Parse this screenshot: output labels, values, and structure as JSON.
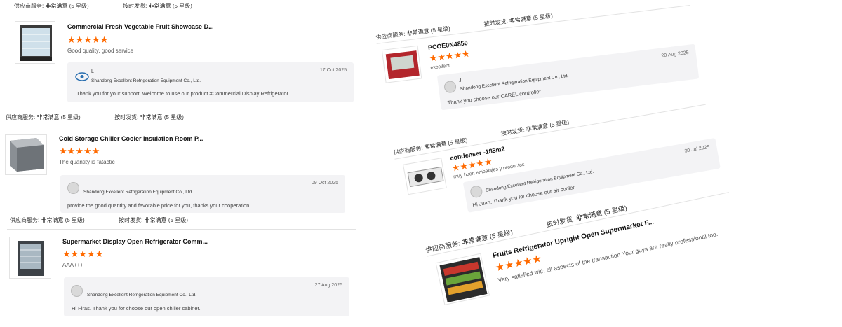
{
  "colors": {
    "star": "#ff6a00",
    "reply_bg": "#f3f3f5"
  },
  "header_labels": {
    "service": "供应商服务:",
    "ontime": "按时发货:",
    "rating": "非常满意",
    "stars": "(5 星级)"
  },
  "reviews_left": [
    {
      "title": "Commercial Fresh Vegetable Fruit Showcase D...",
      "stars": 5,
      "comment": "Good quality, good service",
      "reply": {
        "user": "L",
        "company": "Shandong Excellent Refrigeration Equipment Co., Ltd.",
        "date": "17 Oct 2025",
        "message": "Thank you for your support! Welcome to use our product #Commercial Display Refrigerator"
      }
    },
    {
      "title": "Cold Storage Chiller Cooler Insulation Room P...",
      "stars": 5,
      "comment": "The quantity is fatactic",
      "reply": {
        "company": "Shandong Excellent Refrigeration Equipment Co., Ltd.",
        "date": "09 Oct 2025",
        "message": "provide the good quantity and favorable price for you, thanks your cooperation"
      }
    },
    {
      "title": "Supermarket Display Open Refrigerator Comm...",
      "stars": 5,
      "comment": "AAA+++",
      "reply": {
        "company": "Shandong Excellent Refrigeration Equipment Co., Ltd.",
        "date": "27 Aug 2025",
        "message": "Hi Firas. Thank you for choose our open chiller cabinet."
      }
    }
  ],
  "reviews_right": [
    {
      "title": "PCOE0N4850",
      "stars": 5,
      "comment": "excellent",
      "reply": {
        "user": "J.",
        "company": "Shandong Excellent Refrigeration Equipment Co., Ltd.",
        "date": "20 Aug 2025",
        "message": "Thank you choose our CAREL controller"
      }
    },
    {
      "title": "condenser -185m2",
      "stars": 5,
      "comment": "muy buen embalajes y productos",
      "reply": {
        "company": "Shandong Excellent Refrigeration Equipment Co., Ltd.",
        "date": "30 Jul 2025",
        "message": "Hi Juan, Thank you for choose our air cooler"
      }
    },
    {
      "title": "Fruits Refrigerator Upright Open Supermarket F...",
      "stars": 5,
      "comment": "Very satisfied with all aspects of the transaction.Your guys are really professional too."
    }
  ]
}
